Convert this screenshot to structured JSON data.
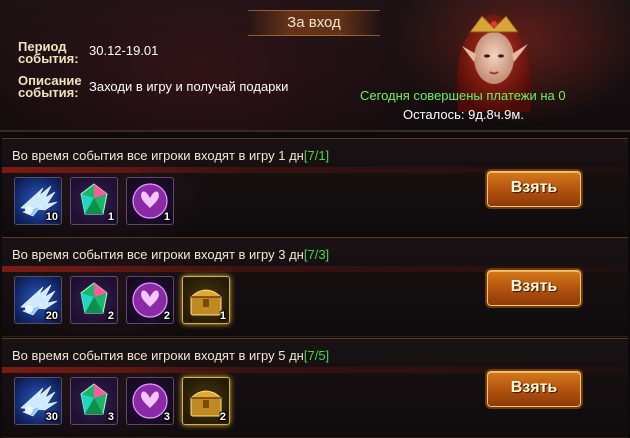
{
  "header": {
    "title": "За вход",
    "period_label_line1": "Период",
    "period_label_line2": "события:",
    "period_value": "30.12-19.01",
    "description_label_line1": "Описание",
    "description_label_line2": "события:",
    "description_value": "Заходи в игру и получай подарки",
    "payments_text": "Сегодня совершены платежи на 0",
    "remaining_text": "Осталось: 9д.8ч.9м."
  },
  "rows": [
    {
      "title": "Во время события все игроки входят в игру 1 дн",
      "progress": "[7/1]",
      "button_label": "Взять",
      "items": [
        {
          "icon": "wing-icon",
          "qty": "10"
        },
        {
          "icon": "gem-icon",
          "qty": "1"
        },
        {
          "icon": "orb-icon",
          "qty": "1"
        }
      ]
    },
    {
      "title": "Во время события все игроки входят в игру 3 дн",
      "progress": "[7/3]",
      "button_label": "Взять",
      "items": [
        {
          "icon": "wing-icon",
          "qty": "20"
        },
        {
          "icon": "gem-icon",
          "qty": "2"
        },
        {
          "icon": "orb-icon",
          "qty": "2"
        },
        {
          "icon": "chest-icon",
          "qty": "1"
        }
      ]
    },
    {
      "title": "Во время события все игроки входят в игру 5 дн",
      "progress": "[7/5]",
      "button_label": "Взять",
      "items": [
        {
          "icon": "wing-icon",
          "qty": "30"
        },
        {
          "icon": "gem-icon",
          "qty": "3"
        },
        {
          "icon": "orb-icon",
          "qty": "3"
        },
        {
          "icon": "chest-icon",
          "qty": "2"
        }
      ]
    }
  ]
}
